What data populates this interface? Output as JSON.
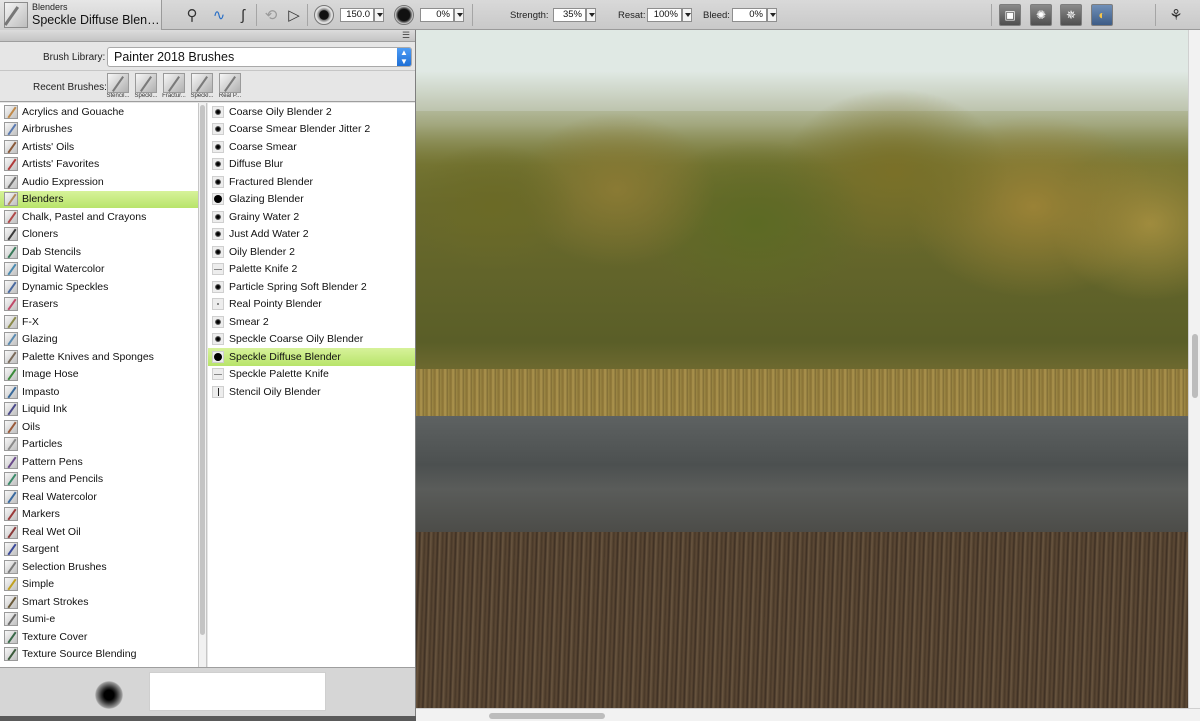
{
  "toolbar": {
    "brush_category": "Blenders",
    "brush_variant": "Speckle Diffuse Blen…",
    "size_value": "150.0",
    "opacity_value": "0%",
    "strength_label": "Strength:",
    "strength_value": "35%",
    "resat_label": "Resat:",
    "resat_value": "100%",
    "bleed_label": "Bleed:",
    "bleed_value": "0%"
  },
  "panel": {
    "library_label": "Brush Library:",
    "library_value": "Painter 2018 Brushes",
    "recent_label": "Recent Brushes:",
    "recent_brushes": [
      "Stencil...",
      "Speckl...",
      "Fractur...",
      "Speckl...",
      "Real P..."
    ],
    "categories": [
      "Acrylics and Gouache",
      "Airbrushes",
      "Artists' Oils",
      "Artists' Favorites",
      "Audio Expression",
      "Blenders",
      "Chalk, Pastel and Crayons",
      "Cloners",
      "Dab Stencils",
      "Digital Watercolor",
      "Dynamic Speckles",
      "Erasers",
      "F-X",
      "Glazing",
      "Palette Knives and Sponges",
      "Image Hose",
      "Impasto",
      "Liquid Ink",
      "Oils",
      "Particles",
      "Pattern Pens",
      "Pens and Pencils",
      "Real Watercolor",
      "Markers",
      "Real Wet Oil",
      "Sargent",
      "Selection Brushes",
      "Simple",
      "Smart Strokes",
      "Sumi-e",
      "Texture Cover",
      "Texture Source Blending"
    ],
    "selected_category_index": 5,
    "variants": [
      "Coarse Oily Blender 2",
      "Coarse Smear Blender Jitter 2",
      "Coarse Smear",
      "Diffuse Blur",
      "Fractured Blender",
      "Glazing Blender",
      "Grainy Water 2",
      "Just Add Water 2",
      "Oily Blender 2",
      "Palette Knife 2",
      "Particle Spring Soft Blender 2",
      "Real Pointy Blender",
      "Smear 2",
      "Speckle Coarse Oily Blender",
      "Speckle Diffuse Blender",
      "Speckle Palette Knife",
      "Stencil Oily Blender"
    ],
    "selected_variant_index": 14
  },
  "colors": {
    "selection": "#c4ea7e",
    "accent_blue": "#2a6fc6"
  }
}
